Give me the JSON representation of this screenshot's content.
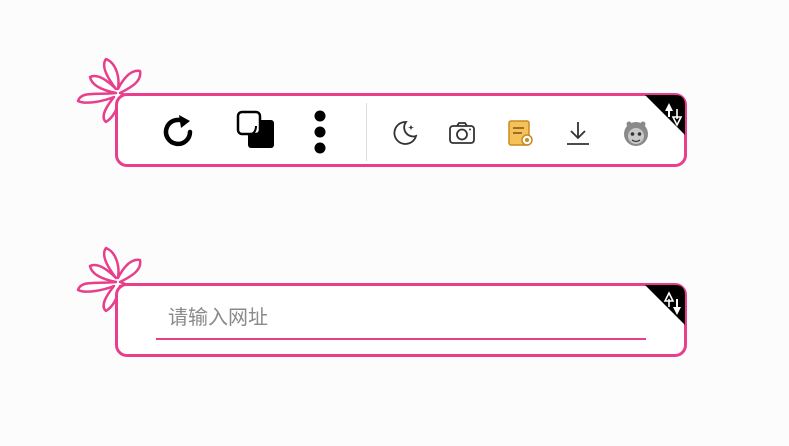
{
  "toolbar": {
    "icons": [
      "refresh-icon",
      "new-window-icon",
      "more-vertical-icon",
      "moon-icon",
      "camera-icon",
      "notes-icon",
      "download-icon",
      "avatar-icon"
    ],
    "accent_color": "#e83e8c"
  },
  "url_bar": {
    "placeholder": "请输入网址",
    "value": ""
  }
}
